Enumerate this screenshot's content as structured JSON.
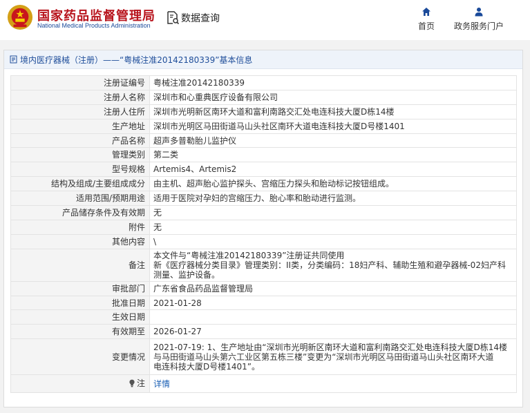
{
  "header": {
    "org_name_cn": "国家药品监督管理局",
    "org_name_en": "National Medical Products Administration",
    "data_query_label": "数据查询",
    "nav": [
      {
        "label": "首页",
        "icon": "home-icon"
      },
      {
        "label": "政务服务门户",
        "icon": "user-icon"
      }
    ]
  },
  "panel": {
    "title": "境内医疗器械（注册）——“粤械注准20142180339”基本信息"
  },
  "rows": [
    {
      "key": "注册证编号",
      "value": "粤械注准20142180339"
    },
    {
      "key": "注册人名称",
      "value": "深圳市和心重典医疗设备有限公司"
    },
    {
      "key": "注册人住所",
      "value": "深圳市光明新区南环大道和富利南路交汇处电连科技大厦D栋14楼"
    },
    {
      "key": "生产地址",
      "value": "深圳市光明区马田街道马山头社区南环大道电连科技大厦D号楼1401"
    },
    {
      "key": "产品名称",
      "value": "超声多普勒胎儿监护仪"
    },
    {
      "key": "管理类别",
      "value": "第二类"
    },
    {
      "key": "型号规格",
      "value": "Artemis4、Artemis2"
    },
    {
      "key": "结构及组成/主要组成成分",
      "value": "由主机、超声胎心监护探头、宫缩压力探头和胎动标记按钮组成。"
    },
    {
      "key": "适用范围/预期用途",
      "value": "适用于医院对孕妇的宫缩压力、胎心率和胎动进行监测。"
    },
    {
      "key": "产品储存条件及有效期",
      "value": "无"
    },
    {
      "key": "附件",
      "value": "无"
    },
    {
      "key": "其他内容",
      "value": "\\"
    }
  ],
  "memo": {
    "key": "备注",
    "line1": "本文件与“粤械注准20142180339”注册证共同使用",
    "line2": "新《医疗器械分类目录》管理类别：II类，分类编码：18妇产科、辅助生殖和避孕器械-02妇产科",
    "line3": "测量、监护设备。"
  },
  "rows2": [
    {
      "key": "审批部门",
      "value": "广东省食品药品监督管理局"
    },
    {
      "key": "批准日期",
      "value": "2021-01-28"
    },
    {
      "key": "生效日期",
      "value": ""
    },
    {
      "key": "有效期至",
      "value": "2026-01-27"
    }
  ],
  "change": {
    "key": "变更情况",
    "line1": "2021-07-19: 1、生产地址由“深圳市光明新区南环大道和富利南路交汇处电连科技大厦D栋14楼",
    "line2": "与马田街道马山头第六工业区第五栋三楼”变更为“深圳市光明区马田街道马山头社区南环大道",
    "line3": "电连科技大厦D号楼1401”。"
  },
  "note": {
    "key": "注",
    "icon": "lightbulb-icon",
    "link_label": "详情"
  },
  "colors": {
    "brand_red": "#b8141d",
    "brand_blue": "#1a4a9a",
    "link_blue": "#1a5fb4"
  }
}
